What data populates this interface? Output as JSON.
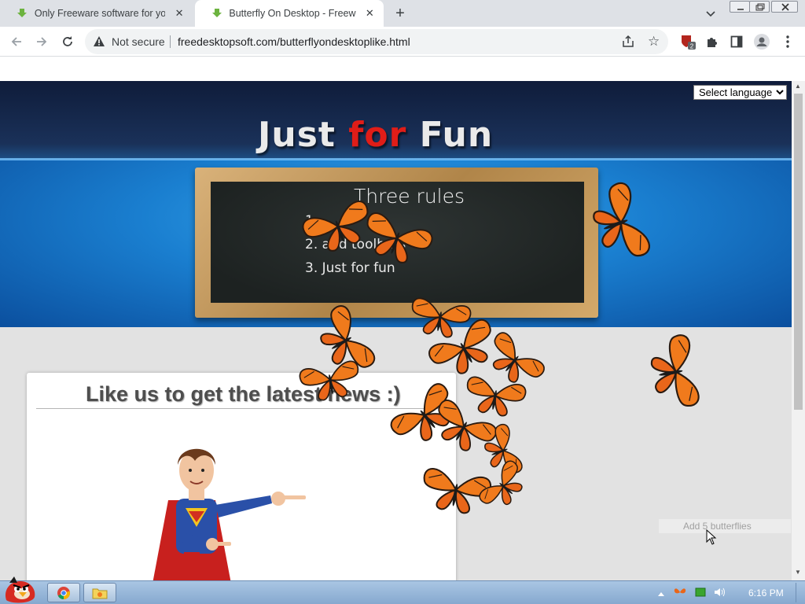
{
  "tabs": [
    {
      "title": "Only Freeware software for your",
      "icon": "download-arrow-icon",
      "active": false
    },
    {
      "title": "Butterfly On Desktop - Freeware",
      "icon": "download-arrow-icon",
      "active": true
    }
  ],
  "omnibox": {
    "security_label": "Not secure",
    "url": "freedesktopsoft.com/butterflyondesktoplike.html"
  },
  "extensions": {
    "badge_count": "2"
  },
  "page": {
    "language_select": {
      "selected": "Select language",
      "options": [
        "Select language"
      ]
    },
    "headline": {
      "word1": "Just",
      "word2": "for",
      "word3": "Fun"
    },
    "chalkboard": {
      "title": "Three rules",
      "rule1": "1.",
      "rule2": "2.                 and toolbars",
      "rule3": "3. Just for fun"
    },
    "like_box": {
      "title": "Like us to get the latest news :)"
    },
    "add_button": "Add 5 butterflies"
  },
  "taskbar": {
    "clock": "6:16 PM"
  },
  "colors": {
    "accent_red": "#e01d18",
    "banner_blue": "#1a7fd0",
    "butterfly_orange": "#f07a1c"
  }
}
